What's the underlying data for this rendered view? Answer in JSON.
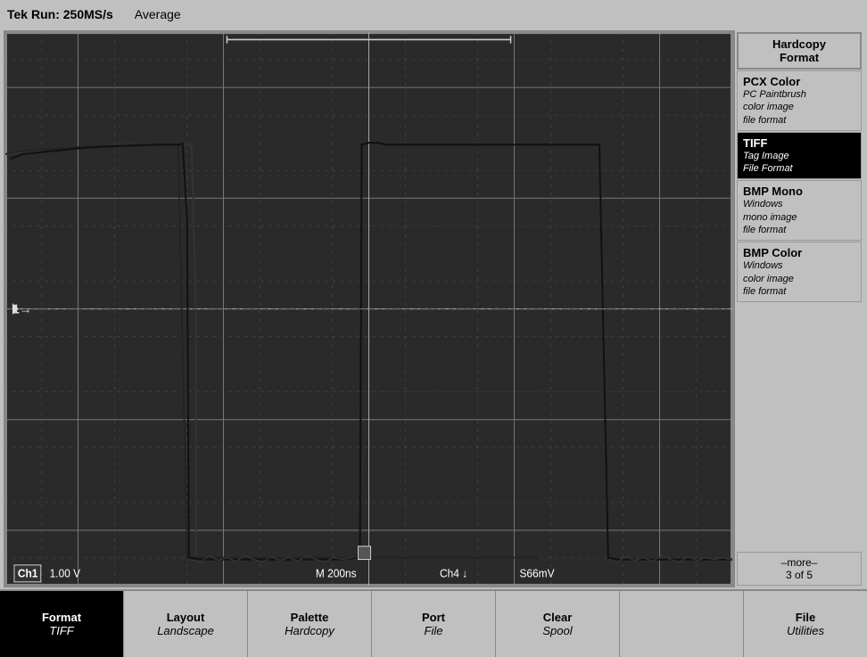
{
  "status": {
    "run_label": "Tek Run: 250MS/s",
    "mode_label": "Average"
  },
  "scope": {
    "ch1_label": "Ch1",
    "voltage_label": "1.00 V",
    "time_label": "M 200ns",
    "ch4_label": "Ch4",
    "trigger_label": "S66mV",
    "trigger_marker": "1→"
  },
  "right_panel": {
    "header": "Hardcopy\nFormat",
    "items": [
      {
        "title": "PCX Color",
        "desc": "PC Paintbrush\ncolor image\nfile format",
        "active": false
      },
      {
        "title": "TIFF",
        "desc": "Tag Image\nFile Format",
        "active": true
      },
      {
        "title": "BMP Mono",
        "desc": "Windows\nmono image\nfile format",
        "active": false
      },
      {
        "title": "BMP Color",
        "desc": "Windows\ncolor image\nfile format",
        "active": false
      }
    ],
    "more_label": "–more–\n3 of 5"
  },
  "toolbar": {
    "buttons": [
      {
        "label": "Format",
        "value": "TIFF",
        "active": true
      },
      {
        "label": "Layout",
        "value": "Landscape",
        "active": false
      },
      {
        "label": "Palette",
        "value": "Hardcopy",
        "active": false
      },
      {
        "label": "Port",
        "value": "File",
        "active": false
      },
      {
        "label": "Clear",
        "value": "Spool",
        "active": false
      },
      {
        "label": "",
        "value": "",
        "active": false
      },
      {
        "label": "File",
        "value": "Utilities",
        "active": false
      }
    ]
  }
}
